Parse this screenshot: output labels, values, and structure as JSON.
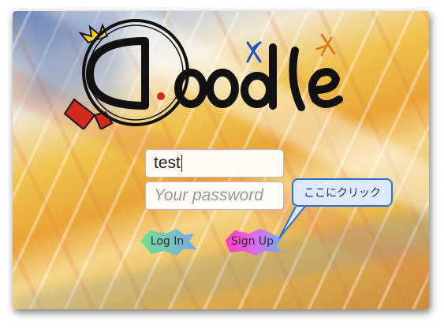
{
  "app": {
    "logo_text": "Doodle"
  },
  "login_form": {
    "username_value": "test",
    "password_placeholder": "Your password"
  },
  "buttons": {
    "login_label": "Log In",
    "signup_label": "Sign Up"
  },
  "annotation": {
    "callout_text": "ここにクリック"
  },
  "colors": {
    "callout_border": "#2a6fd1",
    "callout_fill": "#dbe9fb",
    "login_button_gradient": [
      "#6fe08f",
      "#7aa8e8"
    ],
    "signup_button_gradient": [
      "#ff3cc0",
      "#6fb0ff"
    ]
  }
}
